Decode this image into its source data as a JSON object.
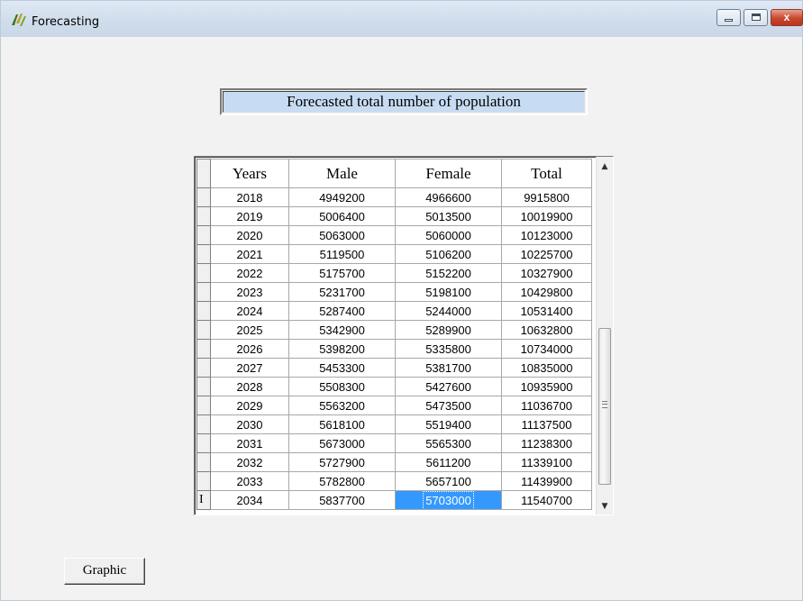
{
  "window": {
    "title": "Forecasting",
    "icon": "app-logo-icon",
    "controls": {
      "minimize": "minimize-icon",
      "maximize": "maximize-icon",
      "close_glyph": "x"
    }
  },
  "heading": "Forecasted total number of population",
  "grid": {
    "columns": [
      "Years",
      "Male",
      "Female",
      "Total"
    ],
    "current_row_marker": "I",
    "rows": [
      [
        "2018",
        "4949200",
        "4966600",
        "9915800"
      ],
      [
        "2019",
        "5006400",
        "5013500",
        "10019900"
      ],
      [
        "2020",
        "5063000",
        "5060000",
        "10123000"
      ],
      [
        "2021",
        "5119500",
        "5106200",
        "10225700"
      ],
      [
        "2022",
        "5175700",
        "5152200",
        "10327900"
      ],
      [
        "2023",
        "5231700",
        "5198100",
        "10429800"
      ],
      [
        "2024",
        "5287400",
        "5244000",
        "10531400"
      ],
      [
        "2025",
        "5342900",
        "5289900",
        "10632800"
      ],
      [
        "2026",
        "5398200",
        "5335800",
        "10734000"
      ],
      [
        "2027",
        "5453300",
        "5381700",
        "10835000"
      ],
      [
        "2028",
        "5508300",
        "5427600",
        "10935900"
      ],
      [
        "2029",
        "5563200",
        "5473500",
        "11036700"
      ],
      [
        "2030",
        "5618100",
        "5519400",
        "11137500"
      ],
      [
        "2031",
        "5673000",
        "5565300",
        "11238300"
      ],
      [
        "2032",
        "5727900",
        "5611200",
        "11339100"
      ],
      [
        "2033",
        "5782800",
        "5657100",
        "11439900"
      ],
      [
        "2034",
        "5837700",
        "5703000",
        "11540700"
      ]
    ],
    "selected_cell": {
      "row": 16,
      "col": 2
    },
    "colors": {
      "selection": "#3399ff",
      "heading_bg": "#c7dcf2"
    }
  },
  "buttons": {
    "graphic": "Graphic"
  }
}
